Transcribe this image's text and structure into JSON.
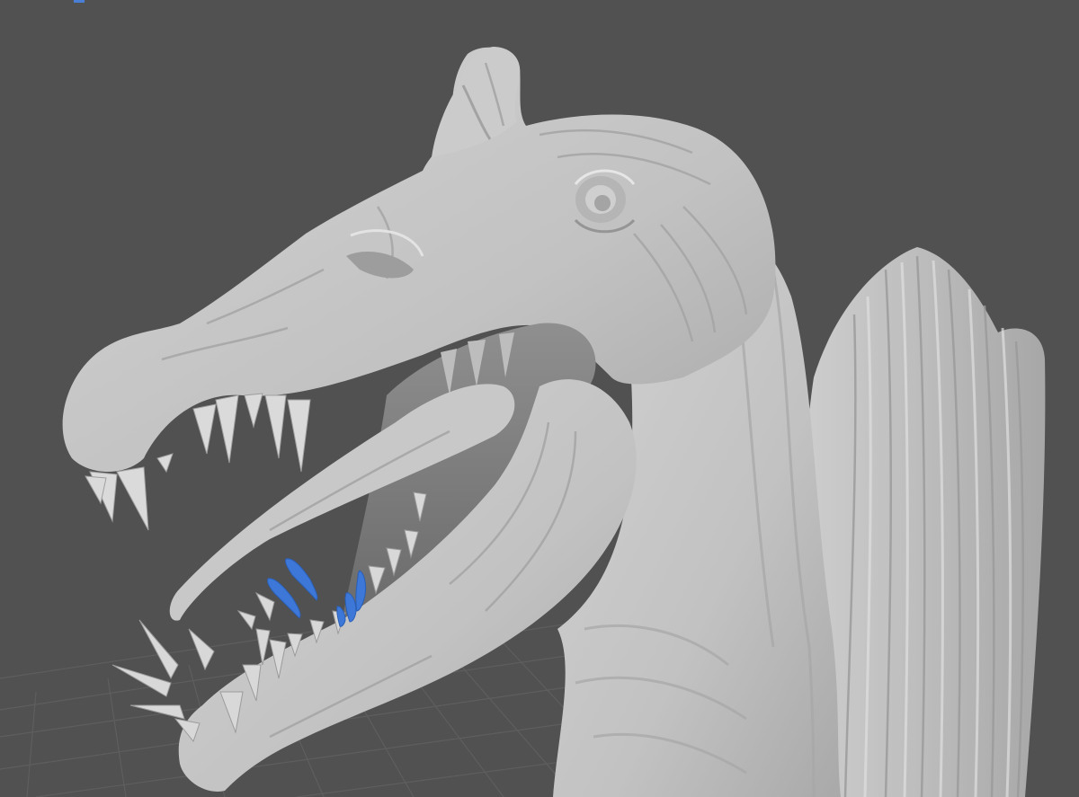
{
  "viewport": {
    "background": "#515151",
    "grid_color": "#5c5c5c",
    "selection_color": "#3d78d8",
    "model_base_color": "#c6c6c6",
    "shading": "clay",
    "object": "spinosaurus-head-sculpt",
    "selected_parts": [
      "lower-jaw-teeth-left",
      "lower-jaw-teeth-center"
    ]
  }
}
